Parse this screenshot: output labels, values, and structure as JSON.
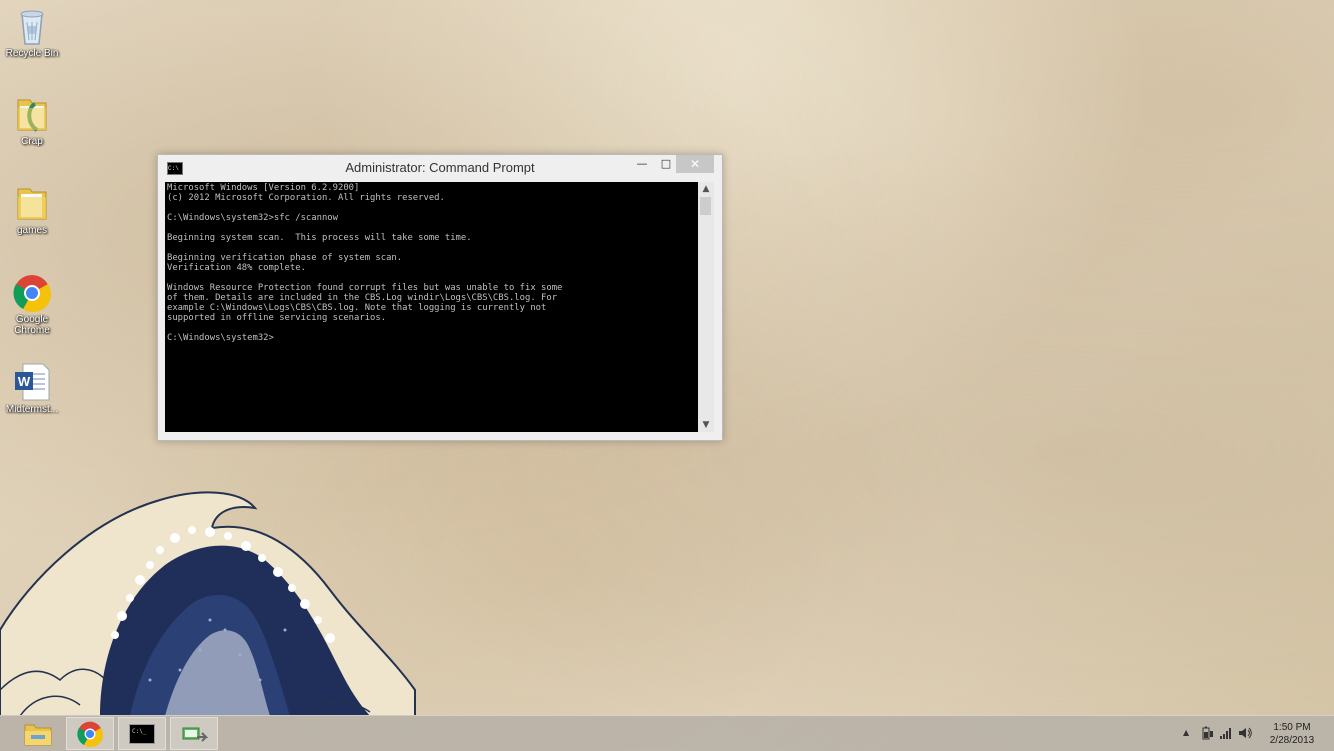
{
  "desktop": {
    "icons": [
      {
        "label": "Recycle Bin",
        "icon": "recycle-bin-icon"
      },
      {
        "label": "Crap",
        "icon": "folder-icon"
      },
      {
        "label": "games",
        "icon": "folder-icon"
      },
      {
        "label": "Google\nChrome",
        "icon": "chrome-icon"
      },
      {
        "label": "Midtermst...",
        "icon": "word-document-icon"
      }
    ]
  },
  "window": {
    "title": "Administrator: Command Prompt",
    "console_lines": [
      "Microsoft Windows [Version 6.2.9200]",
      "(c) 2012 Microsoft Corporation. All rights reserved.",
      "",
      "C:\\Windows\\system32>sfc /scannow",
      "",
      "Beginning system scan.  This process will take some time.",
      "",
      "Beginning verification phase of system scan.",
      "Verification 48% complete.",
      "",
      "Windows Resource Protection found corrupt files but was unable to fix some",
      "of them. Details are included in the CBS.Log windir\\Logs\\CBS\\CBS.log. For",
      "example C:\\Windows\\Logs\\CBS\\CBS.log. Note that logging is currently not",
      "supported in offline servicing scenarios.",
      "",
      "C:\\Windows\\system32>"
    ],
    "controls": {
      "minimize": "—",
      "maximize": "□",
      "close": "✕"
    },
    "scroll_up": "▲",
    "scroll_down": "▼"
  },
  "taskbar": {
    "buttons": [
      {
        "name": "file-explorer",
        "icon": "folder-icon"
      },
      {
        "name": "google-chrome",
        "icon": "chrome-icon"
      },
      {
        "name": "command-prompt",
        "icon": "cmd-icon"
      },
      {
        "name": "network-transfer",
        "icon": "network-icon"
      }
    ],
    "tray": {
      "show_hidden": "▲",
      "time": "1:50 PM",
      "date": "2/28/2013"
    }
  }
}
